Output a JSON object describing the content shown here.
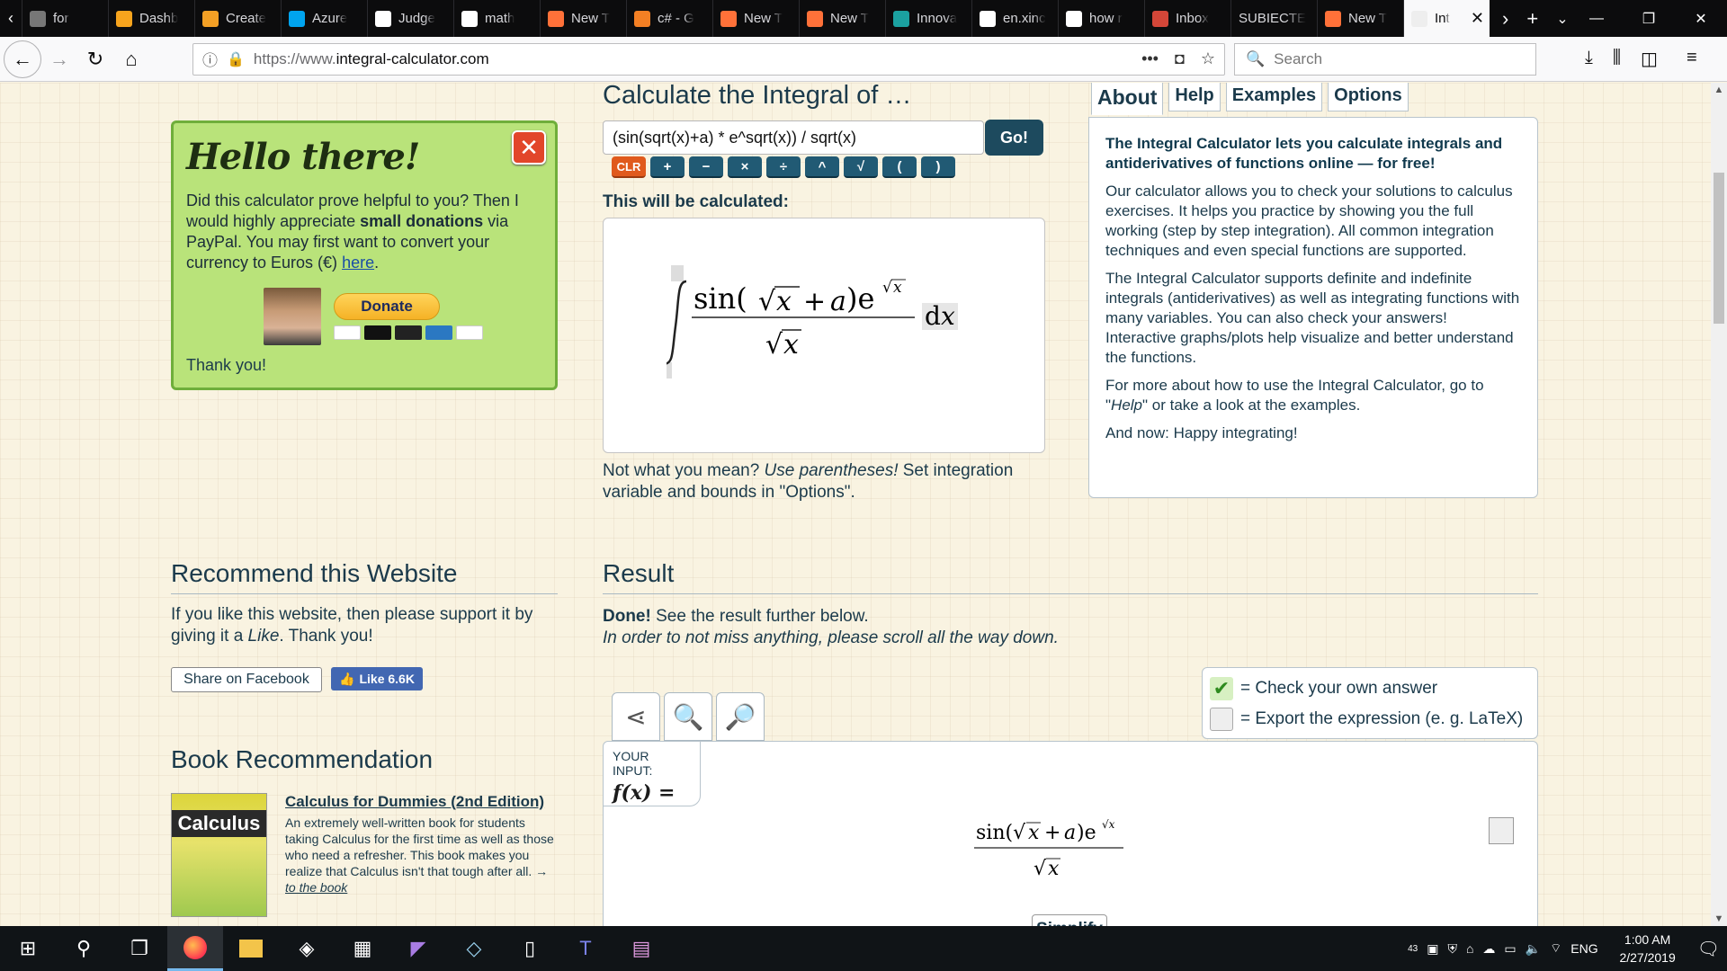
{
  "browser": {
    "tabs": [
      {
        "label": "for",
        "icon": "doc-icon"
      },
      {
        "label": "Dashb",
        "icon": "m-logo-icon"
      },
      {
        "label": "Create",
        "icon": "image-icon"
      },
      {
        "label": "Azure",
        "icon": "windows-logo-icon"
      },
      {
        "label": "Judge",
        "icon": "google-icon"
      },
      {
        "label": "math",
        "icon": "google-icon"
      },
      {
        "label": "New T",
        "icon": "firefox-icon"
      },
      {
        "label": "c# - G",
        "icon": "stackoverflow-icon"
      },
      {
        "label": "New T",
        "icon": "firefox-icon"
      },
      {
        "label": "New T",
        "icon": "firefox-icon"
      },
      {
        "label": "Innova",
        "icon": "innova-icon"
      },
      {
        "label": "en.xinc",
        "icon": "xing-icon"
      },
      {
        "label": "how r",
        "icon": "google-icon"
      },
      {
        "label": "Inbox",
        "icon": "gmail-icon"
      },
      {
        "label": "SUBIECTE",
        "icon": ""
      },
      {
        "label": "New T",
        "icon": "firefox-icon"
      },
      {
        "label": "Int",
        "icon": "integral-icon",
        "active": true
      }
    ],
    "url_prefix": "https://www.",
    "url_domain": "integral-calculator.com",
    "search_placeholder": "Search"
  },
  "hello": {
    "title": "Hello there!",
    "text_1": "Did this calculator prove helpful to you? Then I would highly appreciate ",
    "text_bold": "small donations",
    "text_2": " via PayPal. You may first want to convert your currency to Euros (€) ",
    "link": "here",
    "text_3": ".",
    "donate": "Donate",
    "thanks": "Thank you!"
  },
  "calculator": {
    "title": "Calculate the Integral of …",
    "expression": "(sin(sqrt(x)+a) * e^sqrt(x)) / sqrt(x)",
    "go": "Go!",
    "keys": [
      "CLR",
      "+",
      "−",
      "×",
      "÷",
      "^",
      "√",
      "(",
      ")"
    ],
    "will_be": "This will be calculated:",
    "hint_1": "Not what you mean? ",
    "hint_em": "Use parentheses!",
    "hint_2": " Set integration variable and bounds in \"Options\"."
  },
  "about": {
    "tabs": [
      "About",
      "Help",
      "Examples",
      "Options"
    ],
    "lead": "The Integral Calculator lets you calculate integrals and antiderivatives of functions online — for free!",
    "p1": "Our calculator allows you to check your solutions to calculus exercises. It helps you practice by showing you the full working (step by step integration). All common integration techniques and even special functions are supported.",
    "p2": "The Integral Calculator supports definite and indefinite integrals (antiderivatives) as well as integrating functions with many variables. You can also check your answers! Interactive graphs/plots help visualize and better understand the functions.",
    "p3_1": "For more about how to use the Integral Calculator, go to \"",
    "p3_em": "Help",
    "p3_2": "\" or take a look at the examples.",
    "p4": "And now: Happy integrating!"
  },
  "recommend": {
    "title": "Recommend this Website",
    "text_1": "If you like this website, then please support it by giving it a ",
    "text_em": "Like",
    "text_2": ". Thank you!",
    "share": "Share on Facebook",
    "like": "Like 6.6K"
  },
  "book": {
    "section": "Book Recommendation",
    "cover_text": "Calculus",
    "title": "Calculus for Dummies (2nd Edition)",
    "desc": "An extremely well-written book for students taking Calculus for the first time as well as those who need a refresher. This book makes you realize that Calculus isn't that tough after all. → ",
    "link": "to the book"
  },
  "result": {
    "title": "Result",
    "done": "Done!",
    "done_rest": " See the result further below.",
    "scroll_note": "In order to not miss anything, please scroll all the way down.",
    "legend_check": "= Check your own answer",
    "legend_export": "= Export the expression (e. g. LaTeX)",
    "your_input": "YOUR INPUT:",
    "fx": "f(x) =",
    "simplify": "Simplify"
  },
  "taskbar": {
    "time": "1:00 AM",
    "date": "2/27/2019",
    "lang": "ENG",
    "badge": "43"
  }
}
